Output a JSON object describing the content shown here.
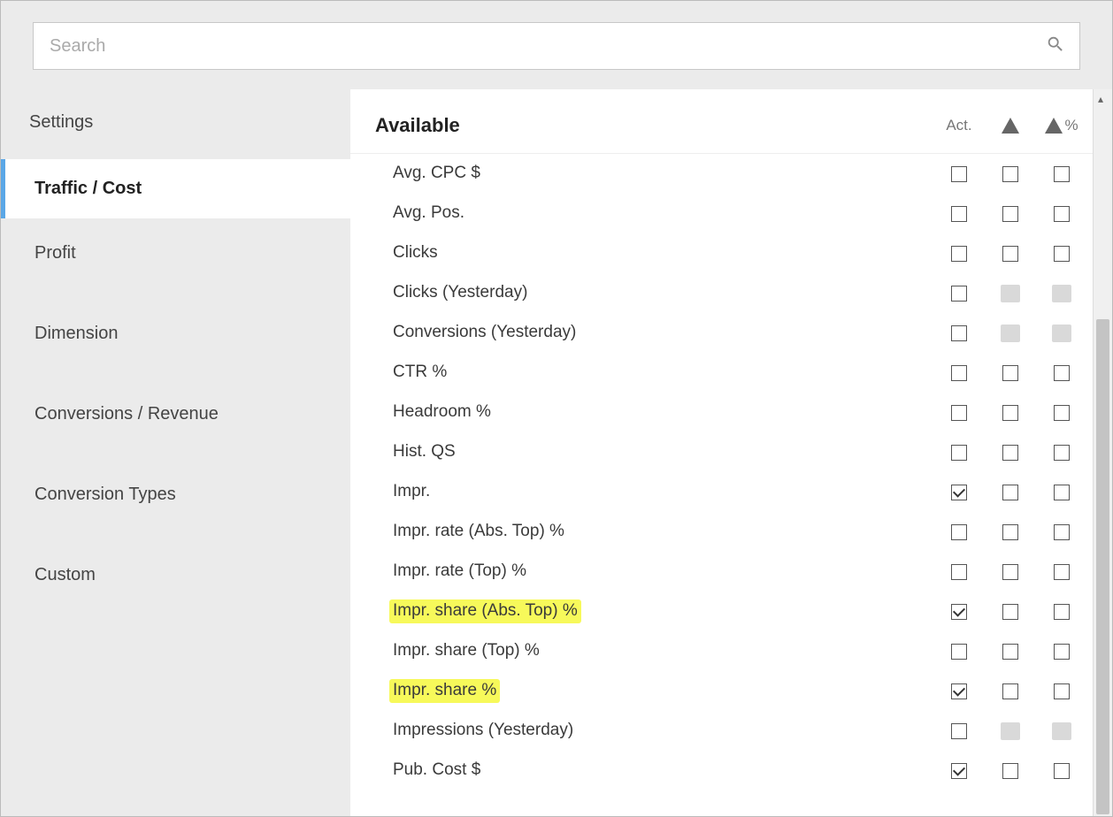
{
  "search": {
    "placeholder": "Search"
  },
  "sidebar": {
    "heading": "Settings",
    "items": [
      {
        "label": "Traffic / Cost",
        "active": true
      },
      {
        "label": "Profit",
        "active": false
      },
      {
        "label": "Dimension",
        "active": false
      },
      {
        "label": "Conversions / Revenue",
        "active": false
      },
      {
        "label": "Conversion Types",
        "active": false
      },
      {
        "label": "Custom",
        "active": false
      }
    ]
  },
  "columns": {
    "title": "Available",
    "act": "Act.",
    "delta_pct_suffix": "%"
  },
  "metrics": [
    {
      "label": "Avg. CPC $",
      "act": false,
      "delta": false,
      "delta_pct": false,
      "disabled_delta": false,
      "highlight": false
    },
    {
      "label": "Avg. Pos.",
      "act": false,
      "delta": false,
      "delta_pct": false,
      "disabled_delta": false,
      "highlight": false
    },
    {
      "label": "Clicks",
      "act": false,
      "delta": false,
      "delta_pct": false,
      "disabled_delta": false,
      "highlight": false
    },
    {
      "label": "Clicks (Yesterday)",
      "act": false,
      "delta": false,
      "delta_pct": false,
      "disabled_delta": true,
      "highlight": false
    },
    {
      "label": "Conversions (Yesterday)",
      "act": false,
      "delta": false,
      "delta_pct": false,
      "disabled_delta": true,
      "highlight": false
    },
    {
      "label": "CTR %",
      "act": false,
      "delta": false,
      "delta_pct": false,
      "disabled_delta": false,
      "highlight": false
    },
    {
      "label": "Headroom %",
      "act": false,
      "delta": false,
      "delta_pct": false,
      "disabled_delta": false,
      "highlight": false
    },
    {
      "label": "Hist. QS",
      "act": false,
      "delta": false,
      "delta_pct": false,
      "disabled_delta": false,
      "highlight": false
    },
    {
      "label": "Impr.",
      "act": true,
      "delta": false,
      "delta_pct": false,
      "disabled_delta": false,
      "highlight": false
    },
    {
      "label": "Impr. rate (Abs. Top) %",
      "act": false,
      "delta": false,
      "delta_pct": false,
      "disabled_delta": false,
      "highlight": false
    },
    {
      "label": "Impr. rate (Top) %",
      "act": false,
      "delta": false,
      "delta_pct": false,
      "disabled_delta": false,
      "highlight": false
    },
    {
      "label": "Impr. share (Abs. Top) %",
      "act": true,
      "delta": false,
      "delta_pct": false,
      "disabled_delta": false,
      "highlight": true
    },
    {
      "label": "Impr. share (Top) %",
      "act": false,
      "delta": false,
      "delta_pct": false,
      "disabled_delta": false,
      "highlight": false
    },
    {
      "label": "Impr. share %",
      "act": true,
      "delta": false,
      "delta_pct": false,
      "disabled_delta": false,
      "highlight": true
    },
    {
      "label": "Impressions (Yesterday)",
      "act": false,
      "delta": false,
      "delta_pct": false,
      "disabled_delta": true,
      "highlight": false
    },
    {
      "label": "Pub. Cost $",
      "act": true,
      "delta": false,
      "delta_pct": false,
      "disabled_delta": false,
      "highlight": false
    }
  ]
}
